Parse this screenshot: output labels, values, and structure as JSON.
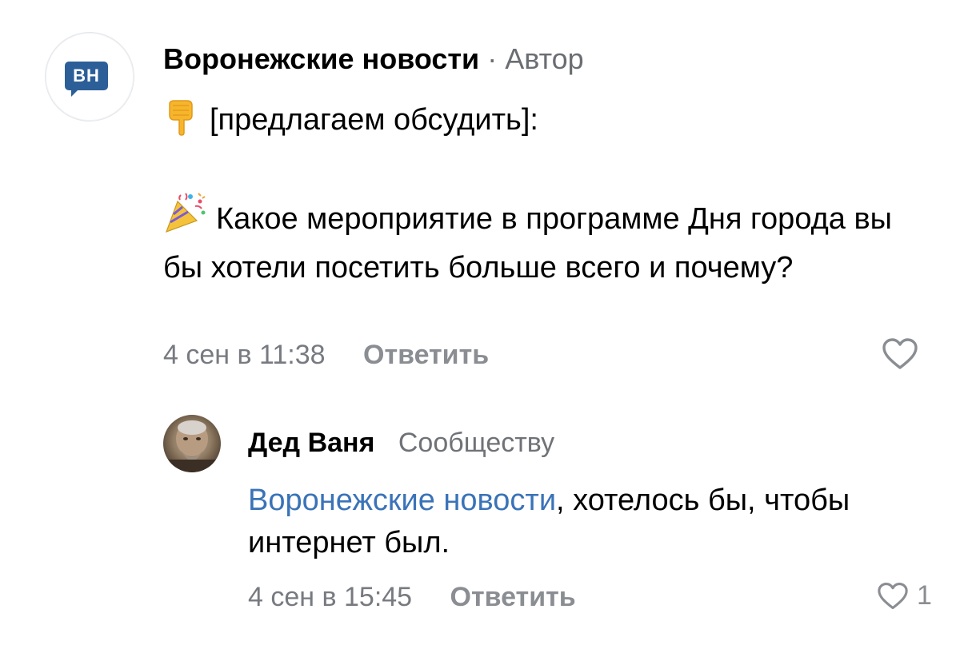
{
  "post": {
    "author": "Воронежские новости",
    "separator": "·",
    "role": "Автор",
    "avatar_text": "ВН",
    "line1": "[предлагаем обсудить]:",
    "line2": "Какое мероприятие в программе Дня города вы бы хотели посетить больше всего и почему?",
    "timestamp": "4 сен в 11:38",
    "reply_label": "Ответить",
    "like_count": ""
  },
  "reply": {
    "author": "Дед Ваня",
    "target": "Сообществу",
    "mention": "Воронежские новости",
    "text": ", хотелось бы, чтобы интернет был.",
    "timestamp": "4 сен в 15:45",
    "reply_label": "Ответить",
    "like_count": "1"
  },
  "icons": {
    "pointing_down": "backhand-index-pointing-down-icon",
    "party_popper": "party-popper-icon",
    "heart": "heart-outline-icon"
  },
  "colors": {
    "brand_badge": "#2c5f98",
    "mention": "#3a73b8",
    "meta_gray": "#777a80"
  }
}
